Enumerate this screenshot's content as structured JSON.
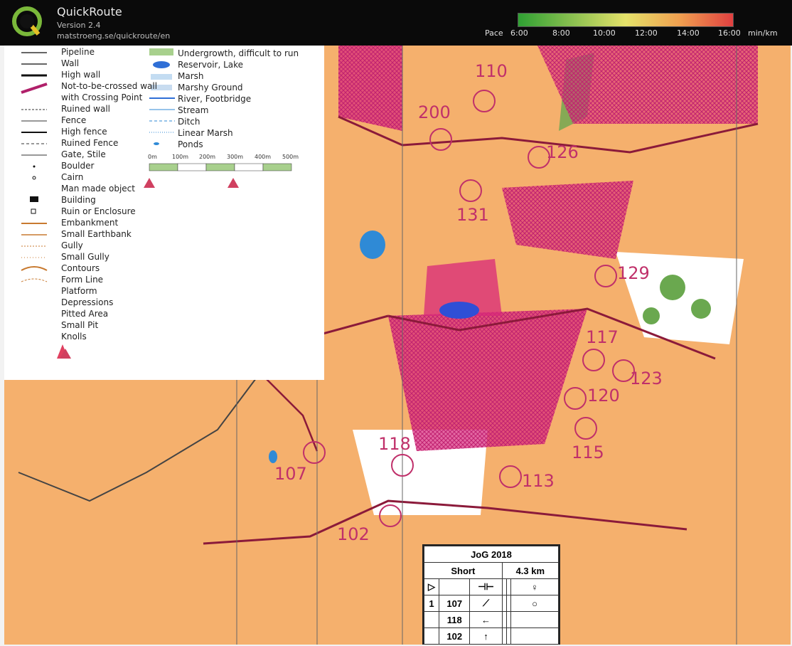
{
  "app": {
    "title": "QuickRoute",
    "version": "Version 2.4",
    "url": "matstroeng.se/quickroute/en"
  },
  "pace": {
    "label": "Pace",
    "unit": "min/km",
    "ticks": [
      "6:00",
      "8:00",
      "10:00",
      "12:00",
      "14:00",
      "16:00"
    ],
    "gradient_colors": [
      "#2fa033",
      "#8ac050",
      "#e5e26a",
      "#f0a050",
      "#e04040"
    ]
  },
  "legend": {
    "items": [
      "Pipeline",
      "Wall",
      "High wall",
      "Not-to-be-crossed wall",
      "with Crossing Point",
      "Ruined wall",
      "Fence",
      "High fence",
      "Ruined Fence",
      "Gate, Stile",
      "Boulder",
      "Cairn",
      "Man made object",
      "Building",
      "Ruin or Enclosure",
      "Embankment",
      "Small Earthbank",
      "Gully",
      "Small Gully",
      "Contours",
      "Form Line",
      "Platform",
      "Depressions",
      "Pitted Area",
      "Small Pit",
      "Knolls"
    ],
    "items_right": [
      "Undergrowth, difficult to run",
      "Reservoir, Lake",
      "Marsh",
      "Marshy Ground",
      "River, Footbridge",
      "Stream",
      "Ditch",
      "Linear Marsh",
      "Ponds"
    ],
    "scale_ticks": [
      "0m",
      "100m",
      "200m",
      "300m",
      "400m",
      "500m"
    ]
  },
  "controls": [
    {
      "num": "110"
    },
    {
      "num": "200"
    },
    {
      "num": "126"
    },
    {
      "num": "131"
    },
    {
      "num": "129"
    },
    {
      "num": "117"
    },
    {
      "num": "123"
    },
    {
      "num": "120"
    },
    {
      "num": "115"
    },
    {
      "num": "118"
    },
    {
      "num": "107"
    },
    {
      "num": "113"
    },
    {
      "num": "102"
    }
  ],
  "card": {
    "event": "JoG 2018",
    "course": "Short",
    "distance": "4.3 km",
    "rows": [
      {
        "n": "1",
        "code": "107",
        "sym": "⟋"
      },
      {
        "n": "",
        "code": "118",
        "sym": "←"
      },
      {
        "n": "",
        "code": "102",
        "sym": "↑"
      }
    ]
  },
  "colors": {
    "map_bg": "#f5b06d",
    "oob": "#d8287a",
    "controls": "#c0306a",
    "green": "#6aa84f"
  }
}
